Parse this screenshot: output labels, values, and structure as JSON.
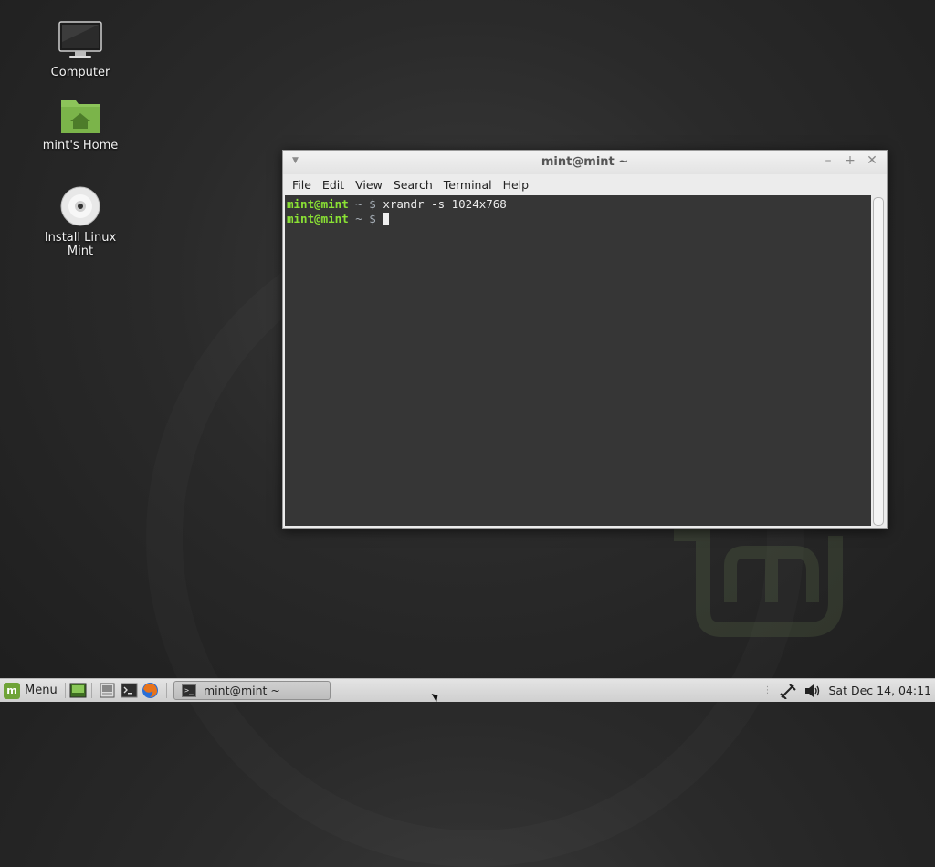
{
  "desktop": {
    "icons": [
      {
        "label": "Computer",
        "icon": "computer-icon"
      },
      {
        "label": "mint's Home",
        "icon": "home-folder-icon"
      },
      {
        "label": "Install Linux Mint",
        "icon": "install-disc-icon"
      }
    ]
  },
  "terminal": {
    "title": "mint@mint ~",
    "menu": [
      "File",
      "Edit",
      "View",
      "Search",
      "Terminal",
      "Help"
    ],
    "lines": [
      {
        "prompt_user": "mint@mint",
        "prompt_sym": " ~ $ ",
        "command": "xrandr -s 1024x768"
      },
      {
        "prompt_user": "mint@mint",
        "prompt_sym": " ~ $ ",
        "command": ""
      }
    ],
    "colors": {
      "prompt": "#8ae234",
      "background": "#363636"
    }
  },
  "panel": {
    "menu_label": "Menu",
    "launchers": [
      "show-desktop-icon",
      "file-manager-icon",
      "terminal-icon",
      "firefox-icon"
    ],
    "task": {
      "label": "mint@mint ~",
      "icon": "terminal-icon"
    },
    "tray": {
      "icons": [
        "network-icon",
        "volume-icon"
      ],
      "clock": "Sat Dec 14, 04:11"
    }
  }
}
